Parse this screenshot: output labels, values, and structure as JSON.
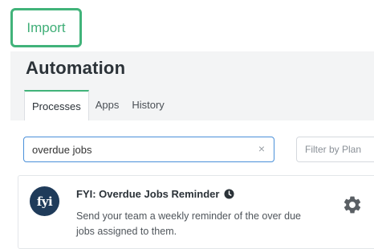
{
  "import_button": {
    "label": "Import",
    "color": "#41b37a"
  },
  "page": {
    "title": "Automation"
  },
  "tabs": [
    {
      "label": "Processes",
      "active": true
    },
    {
      "label": "Apps",
      "active": false
    },
    {
      "label": "History",
      "active": false
    }
  ],
  "search": {
    "value": "overdue jobs",
    "clear_icon": "×"
  },
  "filter": {
    "placeholder": "Filter by Plan"
  },
  "result_card": {
    "logo_text": "fyi",
    "title": "FYI: Overdue Jobs Reminder",
    "description": "Send your team a weekly reminder of the over due jobs assigned to them."
  }
}
